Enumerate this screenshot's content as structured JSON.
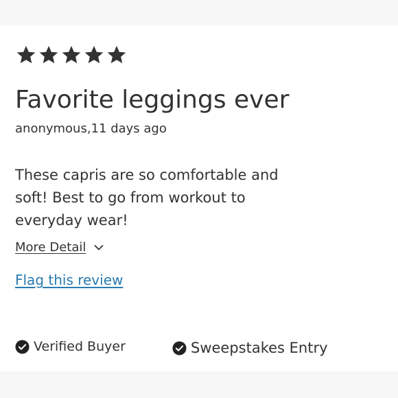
{
  "review": {
    "rating": 5,
    "rating_max": 5,
    "title": "Favorite leggings ever",
    "author_line": "anonymous,11 days ago",
    "body": "These capris are so comfortable and soft! Best to go from workout to everyday wear!",
    "more_detail_label": "More Detail",
    "flag_label": "Flag this review",
    "badges": [
      {
        "label": "Verified Buyer",
        "icon": "check-circle-icon"
      },
      {
        "label": "Sweepstakes Entry",
        "icon": "check-circle-icon"
      }
    ]
  },
  "colors": {
    "text": "#333333",
    "star": "#333333",
    "link": "#2a7ab0",
    "band": "#f7f7f7"
  }
}
